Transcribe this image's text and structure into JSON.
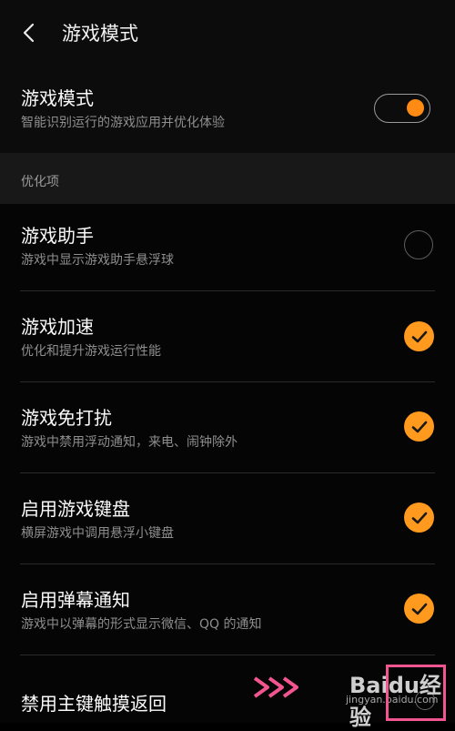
{
  "header": {
    "title": "游戏模式"
  },
  "game_mode": {
    "title": "游戏模式",
    "subtitle": "智能识别运行的游戏应用并优化体验",
    "enabled": true
  },
  "section": {
    "label": "优化项"
  },
  "items": [
    {
      "title": "游戏助手",
      "subtitle": "游戏中显示游戏助手悬浮球",
      "checked": false
    },
    {
      "title": "游戏加速",
      "subtitle": "优化和提升游戏运行性能",
      "checked": true
    },
    {
      "title": "游戏免打扰",
      "subtitle": "游戏中禁用浮动通知，来电、闹钟除外",
      "checked": true
    },
    {
      "title": "启用游戏键盘",
      "subtitle": "横屏游戏中调用悬浮小键盘",
      "checked": true
    },
    {
      "title": "启用弹幕通知",
      "subtitle": "游戏中以弹幕的形式显示微信、QQ 的通知",
      "checked": true
    },
    {
      "title": "禁用主键触摸返回",
      "subtitle": "",
      "checked": false
    }
  ],
  "watermark": {
    "logo": "Baidu经验",
    "url": "jingyan.baidu.com"
  },
  "colors": {
    "accent": "#ff9a1e",
    "annotation": "#f25590"
  }
}
